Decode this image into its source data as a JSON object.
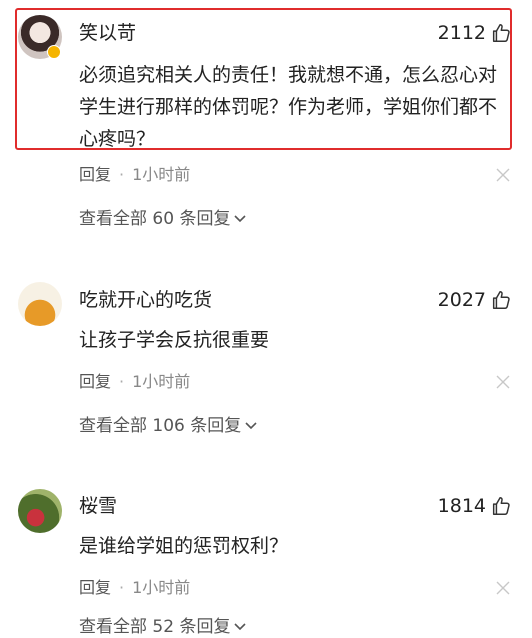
{
  "comments": [
    {
      "username": "笑以苛",
      "likes": "2112",
      "text": "必须追究相关人的责任！我就想不通，怎么忍心对学生进行那样的体罚呢？作为老师，学姐你们都不心疼吗？",
      "reply_label": "回复",
      "time": "1小时前",
      "view_all": "查看全部 60 条回复",
      "verified": true
    },
    {
      "username": "吃就开心的吃货",
      "likes": "2027",
      "text": "让孩子学会反抗很重要",
      "reply_label": "回复",
      "time": "1小时前",
      "view_all": "查看全部 106 条回复"
    },
    {
      "username": "桜雪",
      "likes": "1814",
      "text": "是谁给学姐的惩罚权利？",
      "reply_label": "回复",
      "time": "1小时前",
      "view_all": "查看全部 52 条回复"
    }
  ],
  "separator": "·",
  "colors": {
    "highlight": "#e02c2c",
    "verified_badge": "#f5b400"
  },
  "icons": {
    "like": "thumbs-up-icon",
    "close": "close-icon",
    "expand": "chevron-down-icon"
  }
}
